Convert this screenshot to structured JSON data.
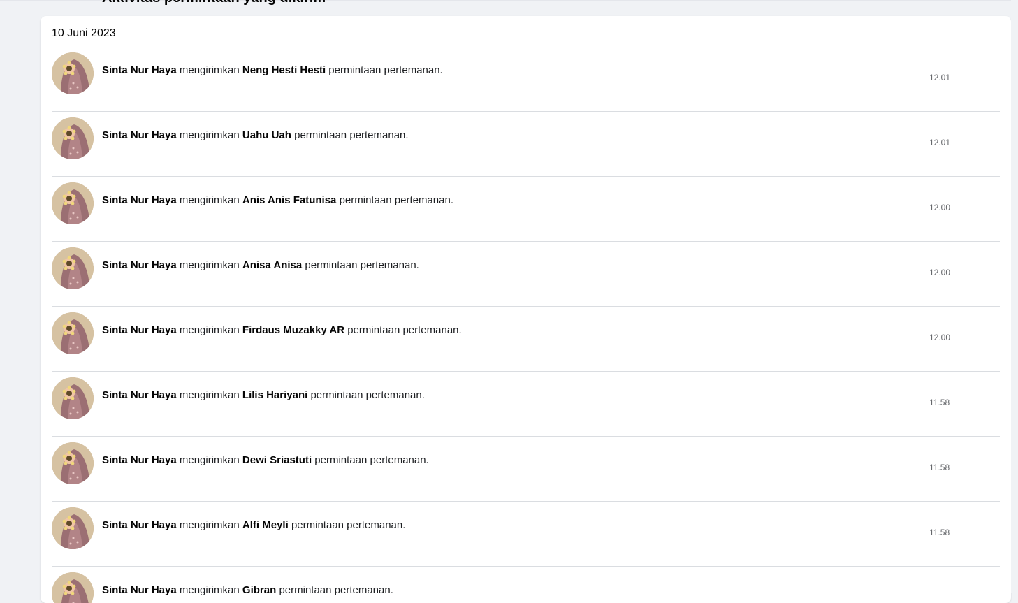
{
  "page": {
    "heading": "Aktivitas permintaan yang dikirim",
    "date_heading": "10 Juni 2023"
  },
  "activity": {
    "sender": "Sinta Nur Haya",
    "verb": "mengirimkan",
    "suffix": "permintaan pertemanan.",
    "items": [
      {
        "recipient": "Neng Hesti Hesti",
        "time": "12.01"
      },
      {
        "recipient": "Uahu Uah",
        "time": "12.01"
      },
      {
        "recipient": "Anis Anis Fatunisa",
        "time": "12.00"
      },
      {
        "recipient": "Anisa Anisa",
        "time": "12.00"
      },
      {
        "recipient": "Firdaus Muzakky AR",
        "time": "12.00"
      },
      {
        "recipient": "Lilis Hariyani",
        "time": "11.58"
      },
      {
        "recipient": "Dewi Sriastuti",
        "time": "11.58"
      },
      {
        "recipient": "Alfi Meyli",
        "time": "11.58"
      },
      {
        "recipient": "Gibran",
        "time": ""
      }
    ]
  },
  "colors": {
    "page_background": "#f0f2f5",
    "card_background": "#ffffff",
    "divider": "#dadde1",
    "secondary_text": "#65676b",
    "avatar_background": "#d6c2a2",
    "avatar_figure": "#9b6f73"
  },
  "icons": {
    "avatar": "hijab-woman-with-flower-avatar-icon"
  }
}
